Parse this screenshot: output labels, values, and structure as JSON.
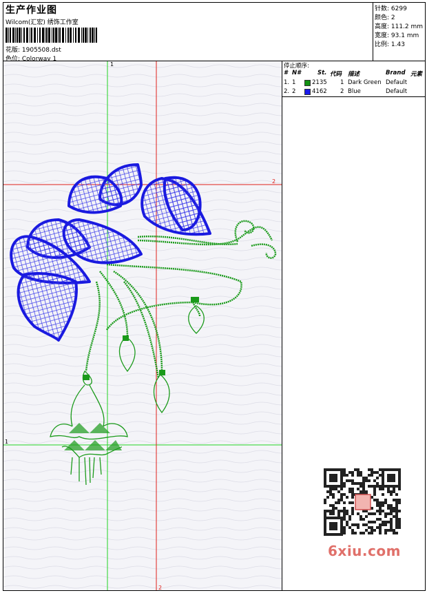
{
  "header": {
    "title": "生产作业图",
    "company": "Wilcom(汇宏) 绣饰工作室",
    "filename": "花版: 1905508.dst",
    "colorway": "色位: Colorway 1"
  },
  "stats": [
    {
      "label": "针数: 6299"
    },
    {
      "label": "颜色: 2"
    },
    {
      "label": "高度: 111.2 mm"
    },
    {
      "label": "宽度: 93.1 mm"
    },
    {
      "label": "比例: 1.43"
    }
  ],
  "stop_sequence": {
    "title": "停止顺序:",
    "columns": [
      "#",
      "N#",
      "St.",
      "代码",
      "描述",
      "Brand",
      "元素"
    ],
    "rows": [
      {
        "idx": "1.",
        "n": "1",
        "st": "2135",
        "code": "1",
        "desc": "Dark Green",
        "brand": "Default",
        "color": "#129112"
      },
      {
        "idx": "2.",
        "n": "2",
        "st": "4162",
        "code": "2",
        "desc": "Blue",
        "brand": "Default",
        "color": "#1a1aeb"
      }
    ]
  },
  "guides": {
    "green_top": "1",
    "green_left": "1",
    "red_right": "2",
    "red_bottom": "2"
  },
  "watermark": "6xiu.com",
  "colors": {
    "green": "#1a9a1a",
    "blue": "#1a1ae0",
    "red": "#e0201a",
    "guide_green": "#21d421"
  }
}
